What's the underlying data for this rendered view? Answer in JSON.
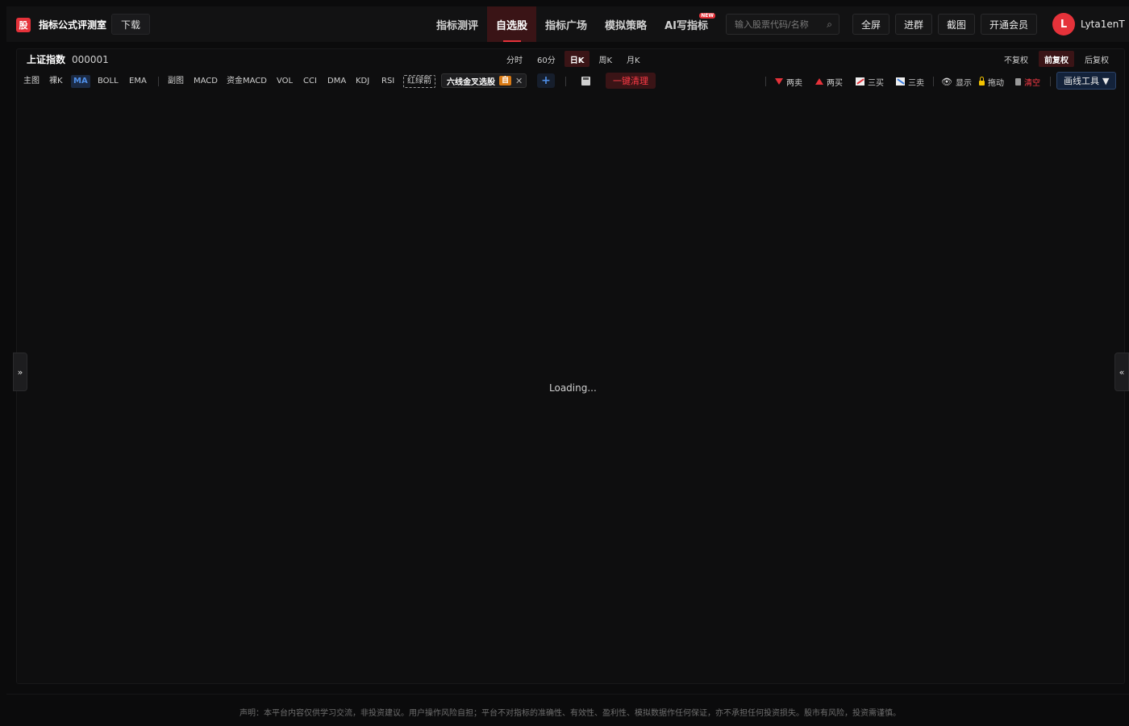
{
  "header": {
    "logo_text": "股",
    "brand": "指标公式评测室",
    "download": "下载",
    "nav": [
      {
        "label": "指标测评",
        "active": false
      },
      {
        "label": "自选股",
        "active": true
      },
      {
        "label": "指标广场",
        "active": false
      },
      {
        "label": "模拟策略",
        "active": false
      },
      {
        "label": "AI写指标",
        "active": false,
        "badge": "NEW"
      }
    ],
    "search_placeholder": "输入股票代码/名称",
    "buttons": [
      "全屏",
      "进群",
      "截图",
      "开通会员"
    ],
    "avatar_letter": "L",
    "username": "Lyta1enT"
  },
  "stock": {
    "name": "上证指数",
    "code": "000001"
  },
  "periods": [
    {
      "label": "分时",
      "active": false
    },
    {
      "label": "60分",
      "active": false
    },
    {
      "label": "日K",
      "active": true
    },
    {
      "label": "周K",
      "active": false
    },
    {
      "label": "月K",
      "active": false
    }
  ],
  "adjustments": [
    {
      "label": "不复权",
      "active": false
    },
    {
      "label": "前复权",
      "active": true
    },
    {
      "label": "后复权",
      "active": false
    }
  ],
  "indicators": {
    "main_label": "主图",
    "main": [
      "裸K",
      "MA",
      "BOLL",
      "EMA"
    ],
    "main_active": "MA",
    "sub_label": "副图",
    "sub": [
      "MACD",
      "资金MACD",
      "VOL",
      "CCI",
      "DMA",
      "KDJ",
      "RSI"
    ],
    "special": "红绿箭",
    "custom_chip": {
      "label": "六线金叉选股",
      "tag": "自"
    },
    "clear_all": "一键清理"
  },
  "draw_tools": {
    "items": [
      "两卖",
      "两买",
      "三买",
      "三卖"
    ],
    "show": "显示",
    "drag": "拖动",
    "clear": "清空",
    "menu": "画线工具"
  },
  "colors": {
    "accent": "#e5323a",
    "active_blue": "#4f8fe8",
    "background": "#0b0b0c"
  },
  "status": {
    "loading": "Loading..."
  },
  "side": {
    "left": "»",
    "right": "«"
  },
  "footer": "声明：本平台内容仅供学习交流，非投资建议。用户操作风险自担；平台不对指标的准确性、有效性、盈利性、模拟数据作任何保证，亦不承担任何投资损失。股市有风险，投资需谨慎。"
}
